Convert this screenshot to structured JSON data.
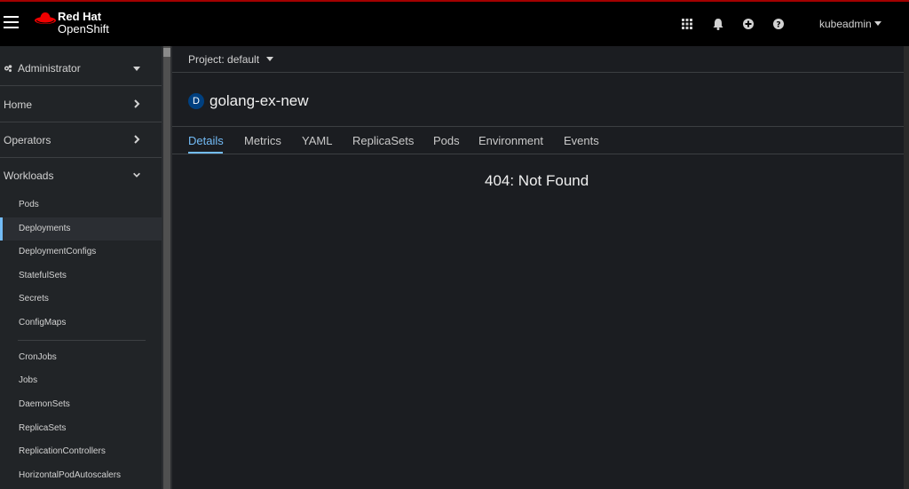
{
  "masthead": {
    "brand_line1": "Red Hat",
    "brand_line2": "OpenShift",
    "icons": [
      "apps-grid-icon",
      "bell-icon",
      "plus-circle-icon",
      "help-icon"
    ],
    "user": "kubeadmin"
  },
  "sidebar": {
    "perspective": "Administrator",
    "sections": [
      {
        "label": "Home"
      },
      {
        "label": "Operators"
      },
      {
        "label": "Workloads"
      }
    ],
    "workloads_items": [
      {
        "label": "Pods"
      },
      {
        "label": "Deployments"
      },
      {
        "label": "DeploymentConfigs"
      },
      {
        "label": "StatefulSets"
      },
      {
        "label": "Secrets"
      },
      {
        "label": "ConfigMaps"
      },
      {
        "label": "CronJobs"
      },
      {
        "label": "Jobs"
      },
      {
        "label": "DaemonSets"
      },
      {
        "label": "ReplicaSets"
      },
      {
        "label": "ReplicationControllers"
      },
      {
        "label": "HorizontalPodAutoscalers"
      }
    ],
    "active_item": "Deployments"
  },
  "main": {
    "project_label": "Project: default",
    "resource_badge": "D",
    "resource_name": "golang-ex-new",
    "tabs": [
      {
        "label": "Details"
      },
      {
        "label": "Metrics"
      },
      {
        "label": "YAML"
      },
      {
        "label": "ReplicaSets"
      },
      {
        "label": "Pods"
      },
      {
        "label": "Environment"
      },
      {
        "label": "Events"
      }
    ],
    "active_tab": "Details",
    "message": "404: Not Found"
  },
  "colors": {
    "accent": "#73bcf7",
    "brand_red": "#ee0000",
    "masthead_bg": "#000000",
    "sidebar_bg": "#212427",
    "page_bg": "#1b1d21"
  }
}
